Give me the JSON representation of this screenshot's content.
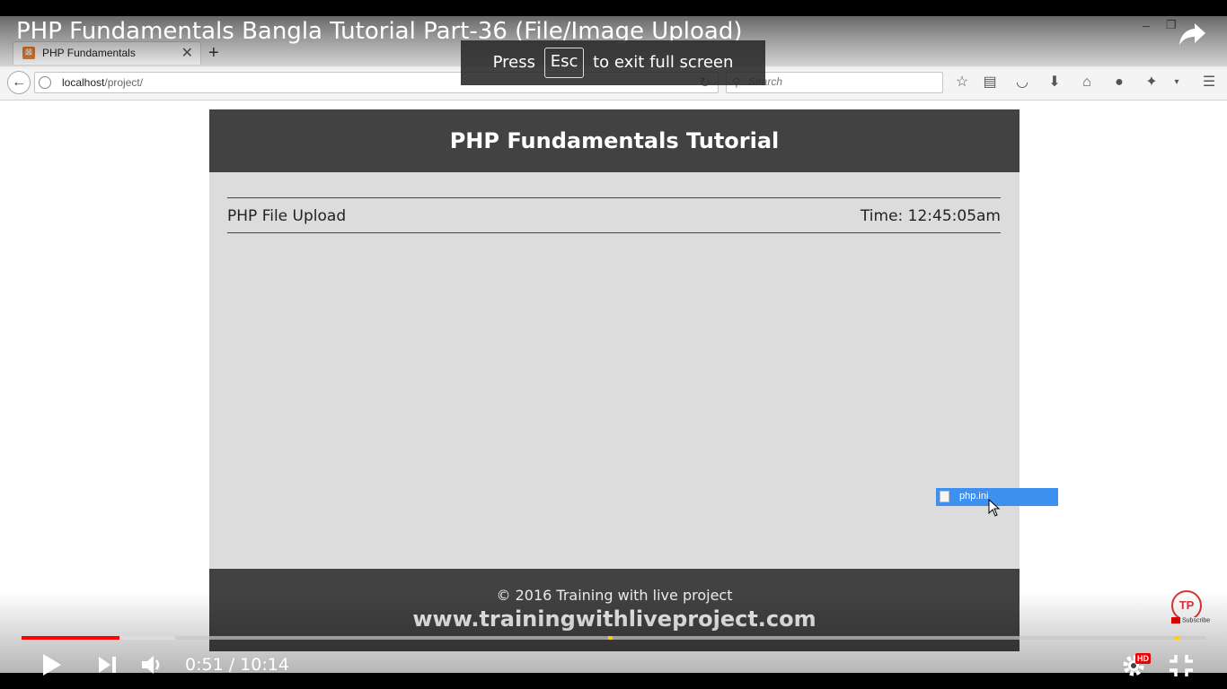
{
  "player": {
    "video_title": "PHP Fundamentals Bangla Tutorial Part-36 (File/Image Upload)",
    "esc_prefix": "Press",
    "esc_key": "Esc",
    "esc_suffix": "to exit full screen",
    "time_current": "0:51",
    "time_separator": " / ",
    "time_total": "10:14",
    "hd_badge": "HD",
    "played_fraction": 0.083,
    "buffered_fraction": 0.13,
    "accent_color": "#ff0000"
  },
  "browser": {
    "tab_title": "PHP Fundamentals",
    "url_host": "localhost",
    "url_path": "/project/",
    "search_placeholder": "Search"
  },
  "page": {
    "header_title": "PHP Fundamentals Tutorial",
    "section_title": "PHP File Upload",
    "time_label": "Time: 12:45:05am",
    "footer_copyright": "© 2016 Training with live project",
    "footer_website": "www.trainingwithliveproject.com"
  },
  "drag": {
    "file_name": "php.ini"
  },
  "channel": {
    "logo_text": "TP",
    "subscribe_label": "Subscribe"
  }
}
